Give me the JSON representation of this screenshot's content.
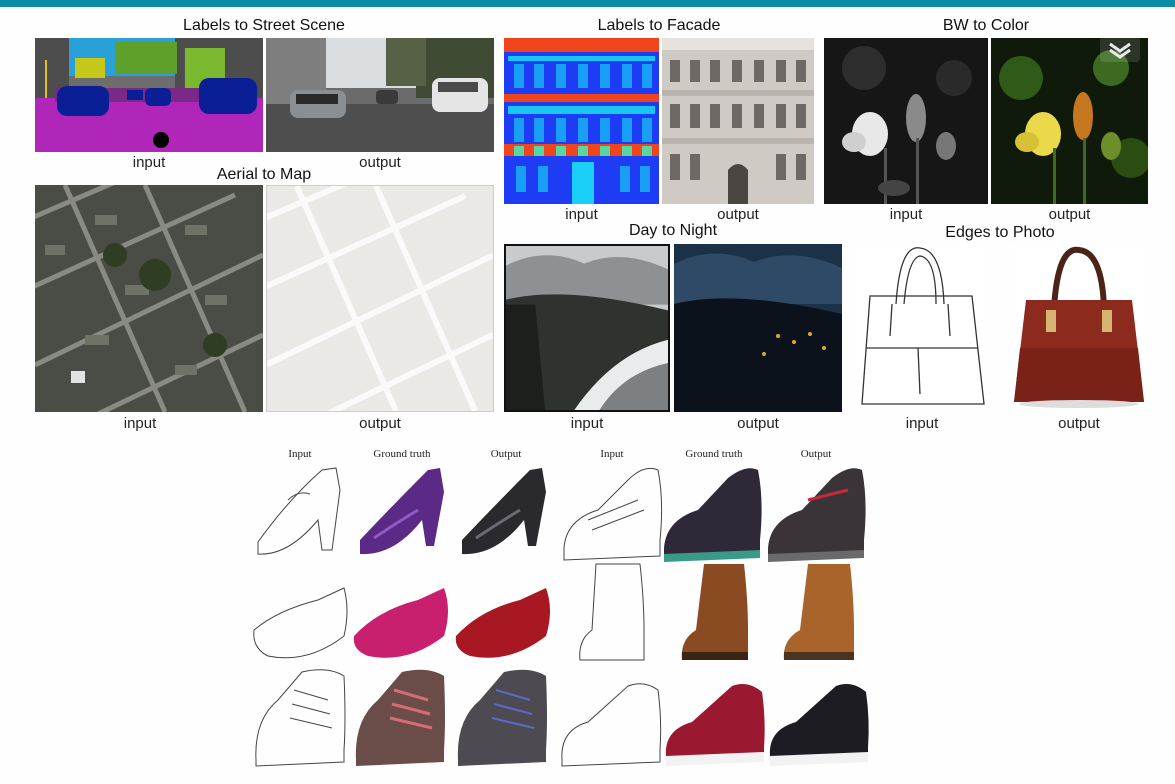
{
  "street": {
    "title": "Labels to Street Scene",
    "input": "input",
    "output": "output"
  },
  "facade": {
    "title": "Labels to Facade",
    "input": "input",
    "output": "output"
  },
  "bw": {
    "title": "BW to Color",
    "input": "input",
    "output": "output"
  },
  "aerial": {
    "title": "Aerial to Map",
    "input": "input",
    "output": "output"
  },
  "day": {
    "title": "Day to Night",
    "input": "input",
    "output": "output"
  },
  "edges": {
    "title": "Edges to Photo",
    "input": "input",
    "output": "output"
  },
  "shoes": {
    "headers": [
      "Input",
      "Ground truth",
      "Output",
      "Input",
      "Ground truth",
      "Output"
    ]
  },
  "colors": {
    "topbar": "#0f8aa6",
    "facade_blue": "#1f3cf5",
    "facade_red": "#f0441c",
    "facade_cyan": "#18c7f0",
    "street_purple": "#b026b8",
    "street_navy": "#0a1f95"
  }
}
